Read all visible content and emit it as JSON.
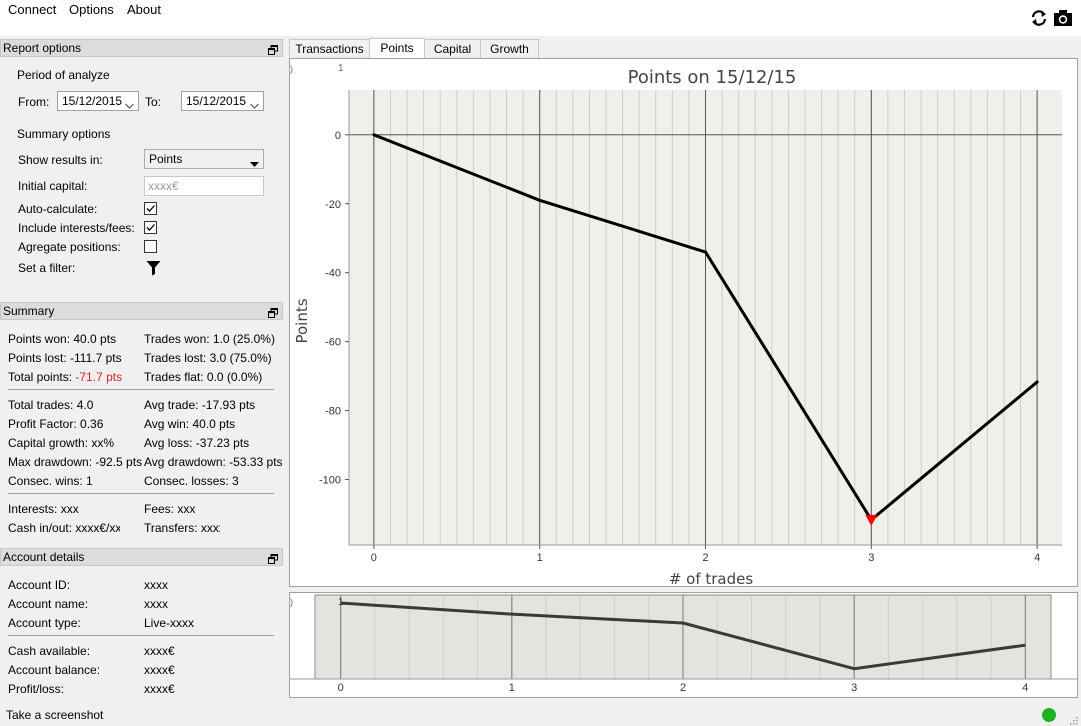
{
  "menu": {
    "connect": "Connect",
    "options": "Options",
    "about": "About"
  },
  "toolbar": {
    "refresh_icon": "refresh-icon",
    "camera_icon": "camera-icon"
  },
  "report_options": {
    "title": "Report options",
    "period_heading": "Period of analyze",
    "from_label": "From:",
    "from_value": "15/12/2015",
    "to_label": "To:",
    "to_value": "15/12/2015",
    "summary_heading": "Summary options",
    "show_results_label": "Show results in:",
    "show_results_value": "Points",
    "initial_capital_label": "Initial capital:",
    "initial_capital_placeholder": "xxxx€",
    "auto_calculate_label": "Auto-calculate:",
    "auto_calculate_checked": true,
    "include_fees_label": "Include interests/fees:",
    "include_fees_checked": true,
    "aggregate_label": "Agregate positions:",
    "aggregate_checked": false,
    "filter_label": "Set a filter:"
  },
  "summary": {
    "title": "Summary",
    "points_won": "Points won: 40.0 pts",
    "trades_won": "Trades won: 1.0 (25.0%)",
    "points_lost": "Points lost: -111.7 pts",
    "trades_lost": "Trades lost: 3.0 (75.0%)",
    "total_points_label": "Total points:",
    "total_points_value": "-71.7 pts",
    "trades_flat": "Trades flat: 0.0 (0.0%)",
    "total_trades": "Total trades: 4.0",
    "avg_trade": "Avg trade: -17.93 pts",
    "profit_factor": "Profit Factor: 0.36",
    "avg_win": "Avg win: 40.0 pts",
    "capital_growth": "Capital growth: xx%",
    "avg_loss": "Avg loss: -37.23 pts",
    "max_drawdown": "Max drawdown: -92.5 pts",
    "avg_drawdown": "Avg drawdown: -53.33 pts",
    "consec_wins": "Consec. wins: 1",
    "consec_losses": "Consec. losses: 3",
    "interests": "Interests: xxx",
    "fees": "Fees: xxx",
    "cash_in_out": "Cash in/out: xxxx€/xxx",
    "transfers": "Transfers: xxxx"
  },
  "account": {
    "title": "Account details",
    "id_label": "Account ID:",
    "id_value": "xxxx",
    "name_label": "Account name:",
    "name_value": "xxxx",
    "type_label": "Account type:",
    "type_value": "Live-xxxx",
    "cash_label": "Cash available:",
    "cash_value": "xxxx€",
    "balance_label": "Account balance:",
    "balance_value": "xxxx€",
    "pl_label": "Profit/loss:",
    "pl_value": "xxxx€"
  },
  "tabs": [
    {
      "label": "Transactions",
      "active": false
    },
    {
      "label": "Points",
      "active": true
    },
    {
      "label": "Capital",
      "active": false
    },
    {
      "label": "Growth",
      "active": false
    }
  ],
  "status": {
    "screenshot_label": "Take a screenshot",
    "connection_color": "#1db31d"
  },
  "chart_data": [
    {
      "type": "line",
      "title": "Points on 15/12/15",
      "xlabel": "# of trades",
      "ylabel": "Points",
      "x": [
        0,
        1,
        2,
        3,
        4
      ],
      "y": [
        0,
        -19,
        -34,
        -111.7,
        -71.7
      ],
      "xlim": [
        -0.15,
        4.15
      ],
      "ylim": [
        -119,
        13
      ],
      "yticks": [
        0,
        -20,
        -40,
        -60,
        -80,
        -100
      ],
      "xticks": [
        0,
        1,
        2,
        3,
        4
      ],
      "min_marker": {
        "x": 3,
        "y": -111.7,
        "color": "#ff0000"
      },
      "grid": true
    },
    {
      "type": "line",
      "title": "",
      "x": [
        0,
        1,
        2,
        3,
        4
      ],
      "y": [
        0,
        -19,
        -34,
        -111.7,
        -71.7
      ],
      "xticks": [
        0,
        1,
        2,
        3,
        4
      ],
      "yticks_label": "1",
      "overview": true
    }
  ]
}
